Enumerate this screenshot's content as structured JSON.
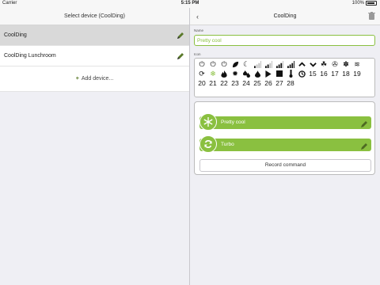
{
  "status": {
    "carrier": "Carrier",
    "time": "5:15 PM",
    "battery": "100%"
  },
  "left": {
    "header": "Select device (CoolDing)",
    "devices": [
      {
        "name": "CoolDing",
        "selected": true
      },
      {
        "name": "CoolDing Lunchroom",
        "selected": false
      }
    ],
    "add_label": "Add device..."
  },
  "right": {
    "title": "CoolDing",
    "name_label": "Name",
    "name_value": "Pretty cool",
    "icon_label": "Icon",
    "icons_row1": [
      "power-icon",
      "power-icon",
      "power-icon",
      "leaf-icon",
      "moon-icon",
      "signal-1-icon",
      "signal-2-icon",
      "signal-3-icon",
      "signal-4-icon",
      "chevron-up-icon",
      "chevron-down-icon",
      "clover-icon",
      "fan-icon",
      "snowflake-small-icon",
      "waves-icon",
      "sync-icon"
    ],
    "icons_row2": [
      "snowflake-icon",
      "flame-icon",
      "sun-icon",
      "drops-icon",
      "drop-icon",
      "play-icon",
      "stop-icon",
      "thermometer-icon",
      "clock-icon"
    ],
    "icon_numbers_row2": [
      "15",
      "16",
      "17",
      "18",
      "19",
      "20",
      "21",
      "22"
    ],
    "icon_numbers_row3": [
      "23",
      "24",
      "25",
      "26",
      "27",
      "28"
    ],
    "selected_icon": "snowflake-icon",
    "commands": [
      {
        "label": "Pretty cool",
        "icon": "snowflake-icon"
      },
      {
        "label": "Turbo",
        "icon": "sync-icon"
      }
    ],
    "record_label": "Record command"
  },
  "colors": {
    "accent": "#8ac040",
    "selected_row": "#d9d9d9"
  }
}
